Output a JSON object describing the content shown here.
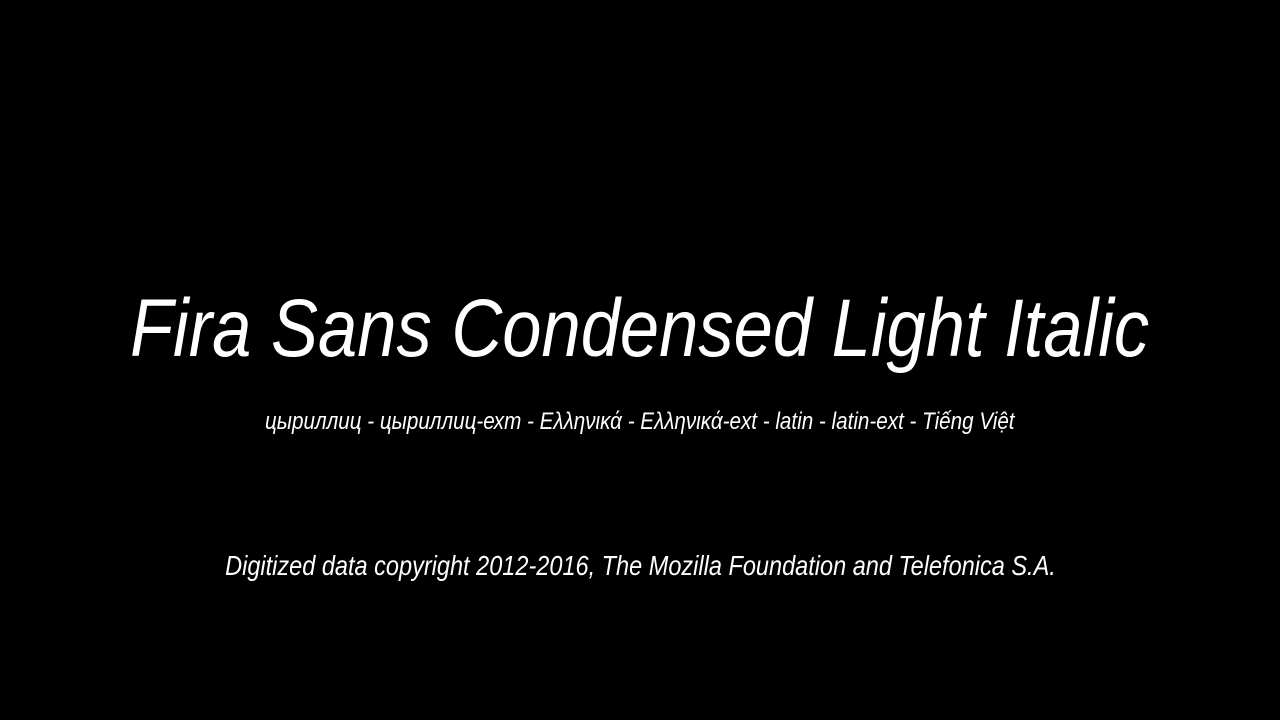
{
  "specimen": {
    "title": "Fira Sans Condensed Light Italic",
    "subsets": "цыриллиц - цыриллиц-ехт - Ελληνικά - Ελληνικά-ext - latin - latin-ext - Tiếng Việt",
    "copyright": "Digitized data copyright 2012-2016, The Mozilla Foundation and Telefonica S.A."
  },
  "colors": {
    "background": "#000000",
    "text": "#ffffff"
  }
}
